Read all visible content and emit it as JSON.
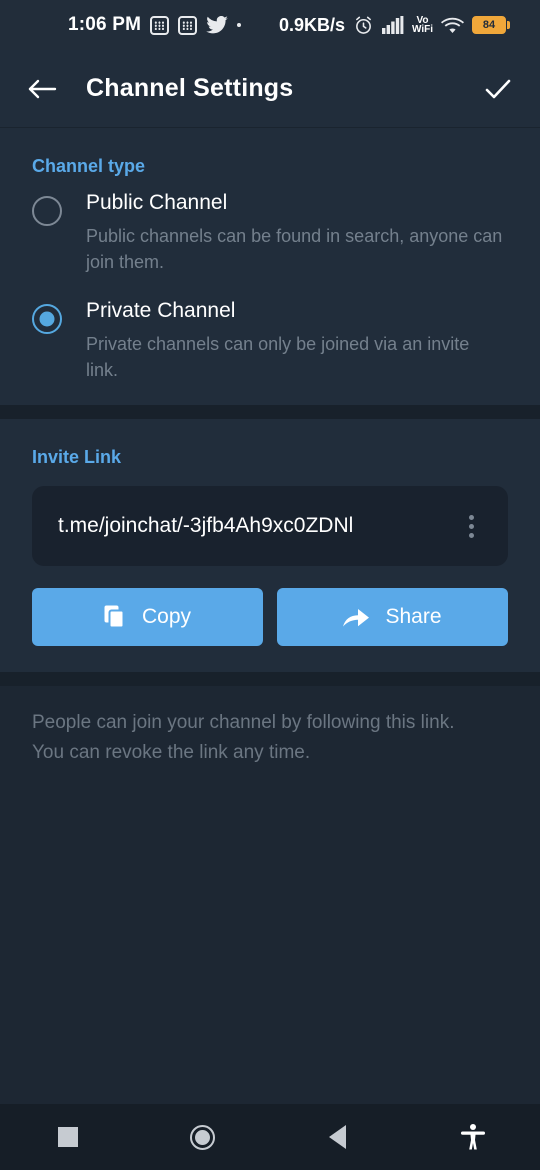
{
  "statusbar": {
    "time": "1:06 PM",
    "app_icon_1": "calculator-icon",
    "app_icon_2": "calculator-icon",
    "twitter_icon": "twitter-icon",
    "dot_icon": "dot-icon",
    "network_speed": "0.9KB/s",
    "alarm_icon": "alarm-clock-icon",
    "signal_icon": "cellular-signal-icon",
    "vowifi_line1": "Vo",
    "vowifi_line2": "WiFi",
    "wifi_icon": "wifi-icon",
    "battery_level": "84"
  },
  "appbar": {
    "back_icon": "back-arrow-icon",
    "title": "Channel Settings",
    "done_icon": "checkmark-icon"
  },
  "channel_type": {
    "header": "Channel type",
    "options": [
      {
        "title": "Public Channel",
        "description": "Public channels can be found in search, anyone can join them.",
        "selected": false
      },
      {
        "title": "Private Channel",
        "description": "Private channels can only be joined via an invite link.",
        "selected": true
      }
    ]
  },
  "invite_link": {
    "header": "Invite Link",
    "url": "t.me/joinchat/-3jfb4Ah9xc0ZDNl",
    "menu_icon": "more-vertical-icon",
    "copy_label": "Copy",
    "copy_icon": "copy-icon",
    "share_label": "Share",
    "share_icon": "share-arrow-icon",
    "hint": "People can join your channel by following this link. You can revoke the link any time."
  },
  "navbar": {
    "recents_icon": "square-recents-icon",
    "home_icon": "circle-home-icon",
    "back_icon": "triangle-back-icon",
    "accessibility_icon": "accessibility-icon"
  },
  "colors": {
    "accent": "#5aa9e8",
    "surface": "#212d3b",
    "background": "#1d2733",
    "field": "#19222e",
    "battery": "#f0a73a"
  }
}
